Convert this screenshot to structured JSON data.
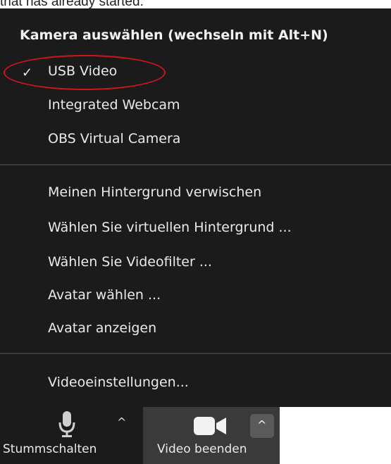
{
  "caption": "that has already started.",
  "menu": {
    "header": "Kamera auswählen (wechseln mit Alt+N)",
    "cameras": [
      {
        "label": "USB Video",
        "checked": true
      },
      {
        "label": "Integrated Webcam",
        "checked": false
      },
      {
        "label": "OBS Virtual Camera",
        "checked": false
      }
    ],
    "effects": [
      "Meinen Hintergrund verwischen",
      "Wählen Sie virtuellen Hintergrund ...",
      "Wählen Sie Videofilter ...",
      "Avatar wählen ...",
      "Avatar anzeigen"
    ],
    "settings": "Videoeinstellungen...",
    "checkmark": "✓"
  },
  "toolbar": {
    "mute_label": "Stummschalten",
    "video_label": "Video beenden",
    "chevron": "^"
  },
  "icons": {
    "mic": "microphone-icon",
    "camera": "video-camera-icon",
    "check": "checkmark-icon"
  },
  "colors": {
    "menu_bg": "#1b1b1b",
    "highlight_ellipse": "#d0161c",
    "active_group": "#3a3a3a"
  }
}
